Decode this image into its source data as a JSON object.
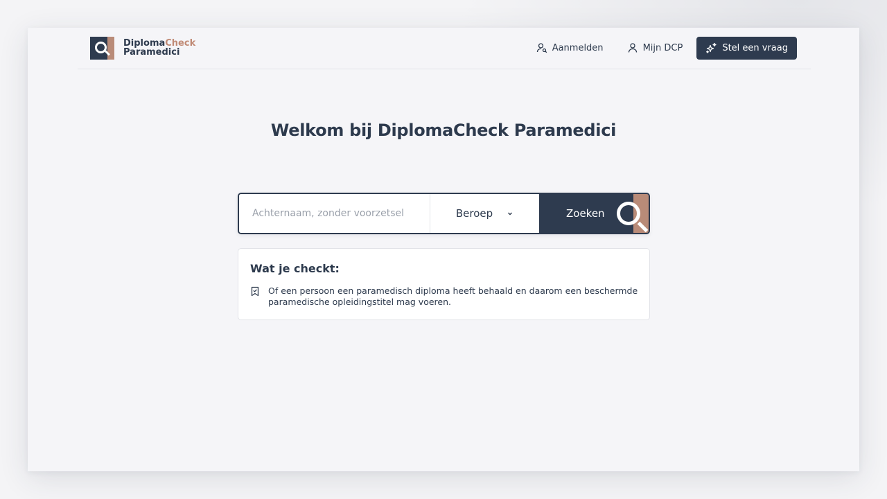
{
  "brand": {
    "name_part1": "Diploma",
    "name_part2": "Check",
    "name_line2": "Paramedici",
    "primary_color": "#2e3b4f",
    "accent_color": "#b98b78"
  },
  "nav": {
    "login_label": "Aanmelden",
    "login_icon": "user-search-icon",
    "account_label": "Mijn DCP",
    "account_icon": "user-icon",
    "ask_label": "Stel een vraag",
    "ask_icon": "sparkles-icon"
  },
  "main": {
    "title": "Welkom bij DiplomaCheck Paramedici"
  },
  "search": {
    "placeholder": "Achternaam, zonder voorzetsel",
    "value": "",
    "profession_selected": "Beroep",
    "submit_label": "Zoeken"
  },
  "info": {
    "title": "Wat je checkt:",
    "icon": "bookmark-check-icon",
    "text": "Of een persoon een paramedisch diploma heeft behaald en daarom een beschermde paramedische opleidingstitel mag voeren."
  }
}
